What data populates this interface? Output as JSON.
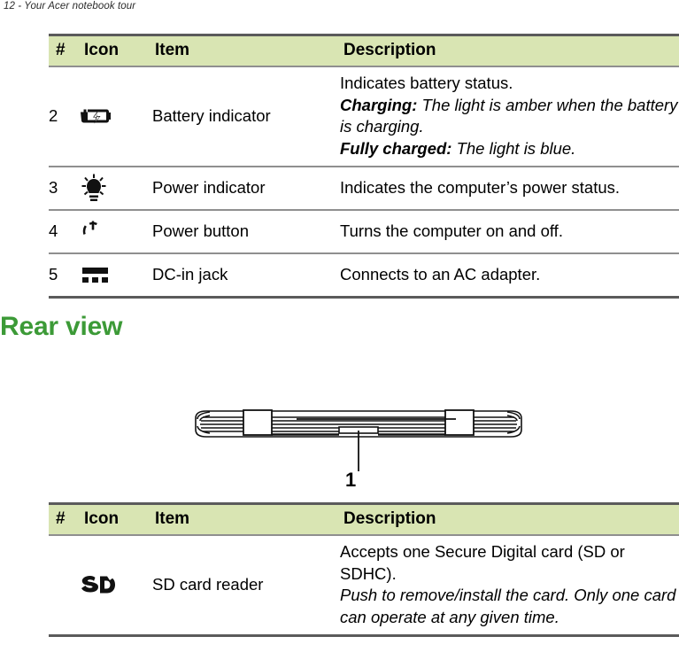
{
  "page": {
    "running_header": "12 - Your Acer notebook tour"
  },
  "table_top": {
    "columns": [
      "#",
      "Icon",
      "Item",
      "Description"
    ],
    "rows": [
      {
        "num": "2",
        "icon": "battery-charging-icon",
        "item": "Battery indicator",
        "desc_lines": [
          {
            "style": "plain",
            "text": "Indicates battery status."
          },
          {
            "style": "italic",
            "bold_lead": "Charging:",
            "text": " The light is amber when the battery is charging."
          },
          {
            "style": "italic",
            "bold_lead": "Fully charged:",
            "text": " The light is blue."
          }
        ]
      },
      {
        "num": "3",
        "icon": "power-indicator-lamp-icon",
        "item": "Power indicator",
        "desc_lines": [
          {
            "style": "plain",
            "text": "Indicates the computer’s power status."
          }
        ]
      },
      {
        "num": "4",
        "icon": "power-button-icon",
        "item": "Power button",
        "desc_lines": [
          {
            "style": "plain",
            "text": "Turns the computer on and off."
          }
        ]
      },
      {
        "num": "5",
        "icon": "dc-in-jack-icon",
        "item": "DC-in jack",
        "desc_lines": [
          {
            "style": "plain",
            "text": "Connects to an AC adapter."
          }
        ]
      }
    ]
  },
  "section": {
    "heading": "Rear view",
    "figure": {
      "name": "laptop-rear-view-illustration",
      "callout_label": "1"
    }
  },
  "table_bottom": {
    "columns": [
      "#",
      "Icon",
      "Item",
      "Description"
    ],
    "rows": [
      {
        "num": "",
        "icon": "sd-card-logo-icon",
        "item": "SD card reader",
        "desc_lines": [
          {
            "style": "plain",
            "text": "Accepts one Secure Digital card (SD or SDHC)."
          },
          {
            "style": "italic",
            "bold_lead": "",
            "text": "Push to remove/install the card. Only one card can operate at any given time."
          }
        ]
      }
    ]
  },
  "colors": {
    "header_row_green": "#d9e5b3",
    "heading_green": "#3c9a37",
    "rule_dark": "#5b5b5b",
    "rule_light": "#8f8f8f"
  }
}
